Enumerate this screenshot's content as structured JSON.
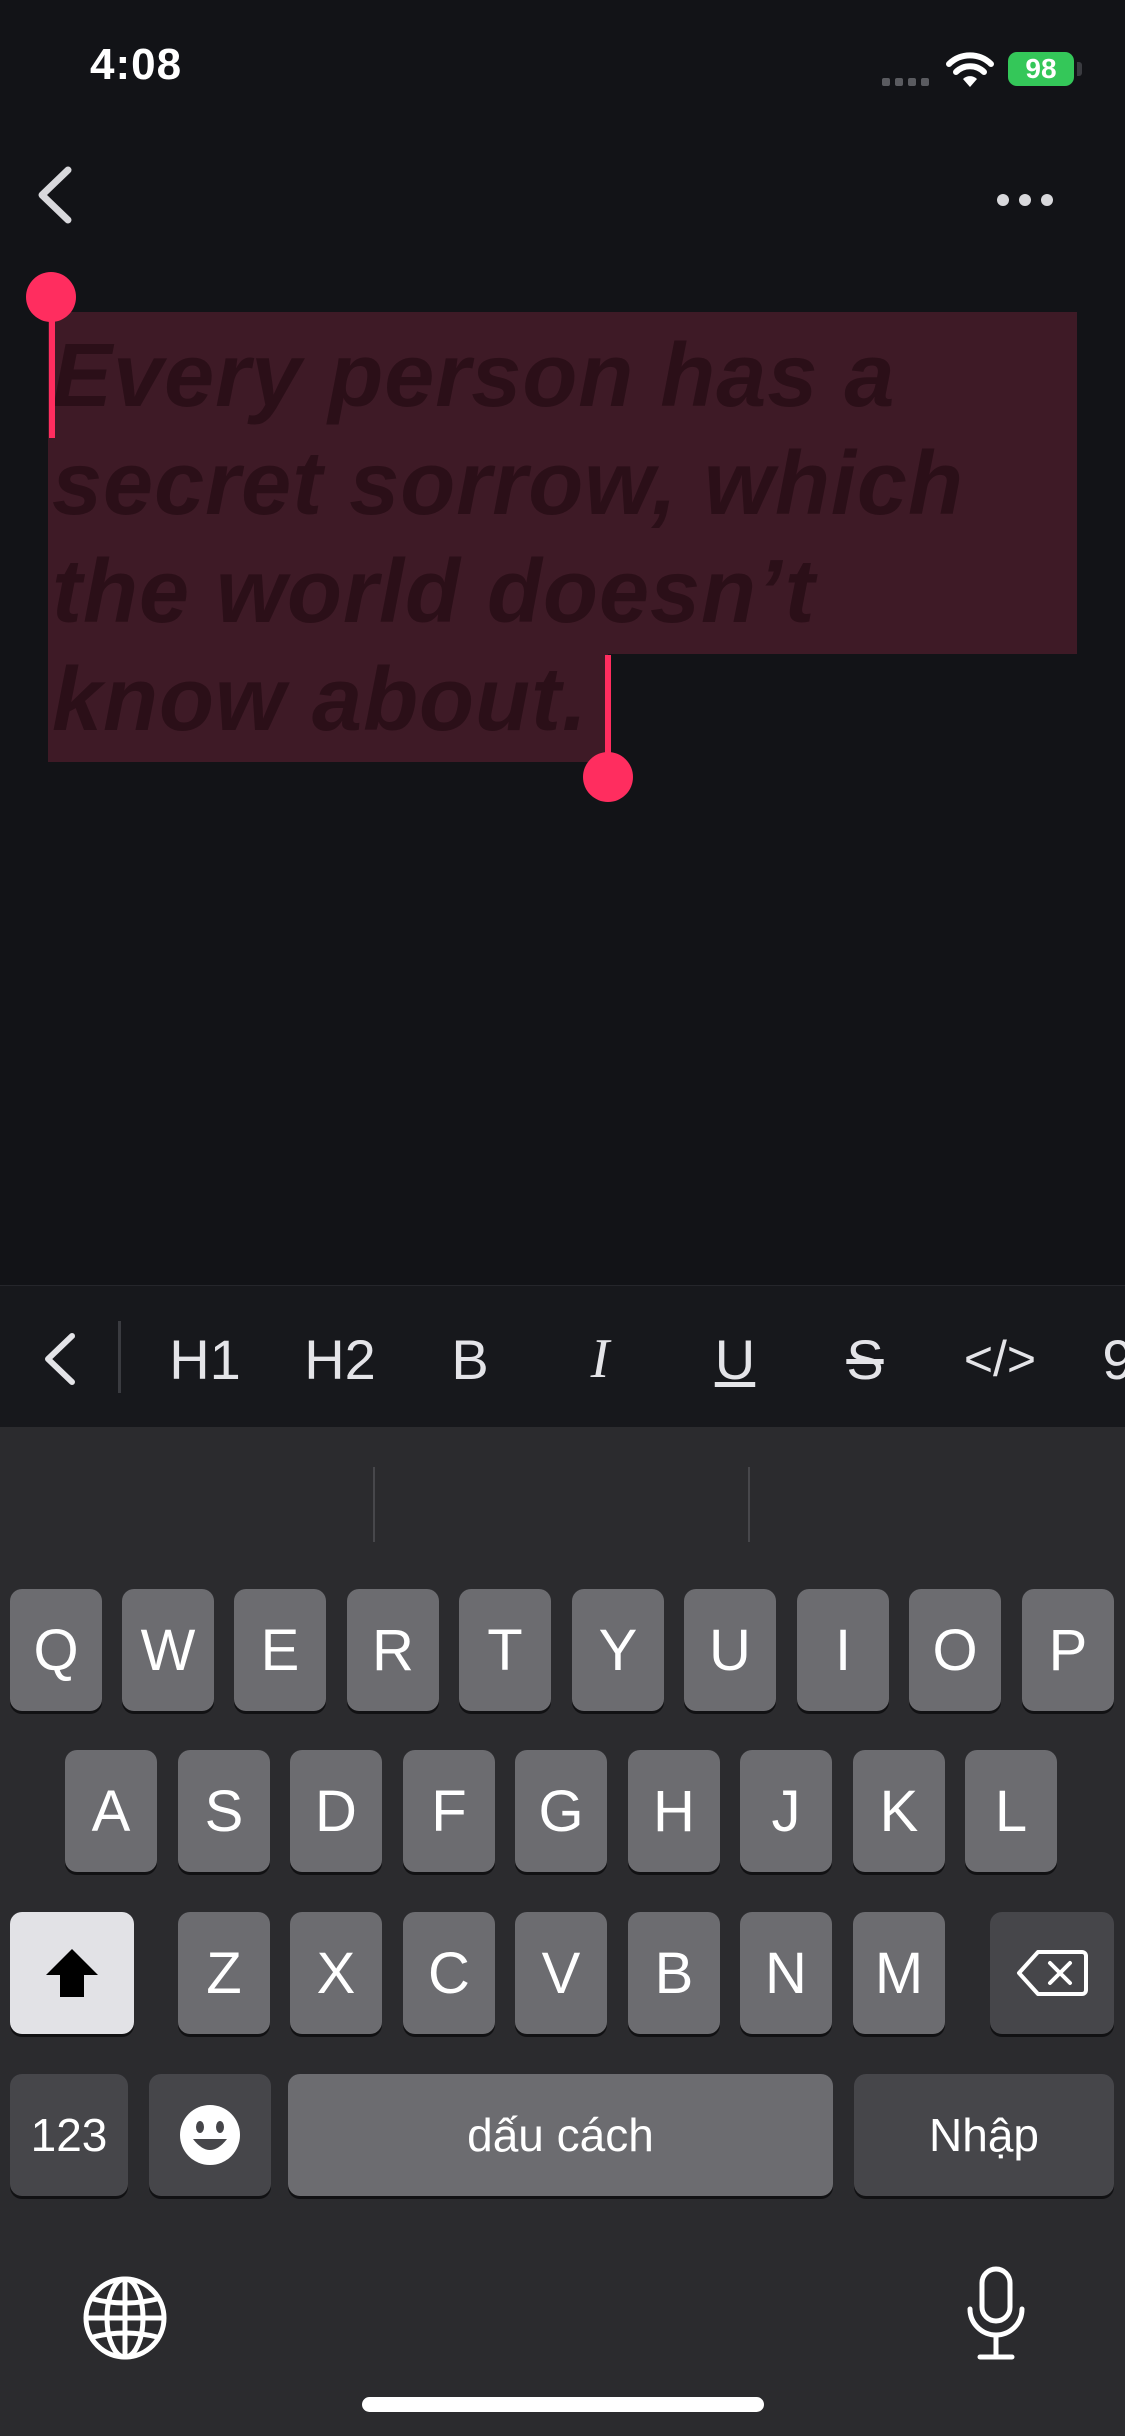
{
  "status_bar": {
    "time": "4:08",
    "battery_level": "98"
  },
  "nav": {
    "back_icon": "chevron-left-icon",
    "more_icon": "ellipsis-icon"
  },
  "editor": {
    "quote_text": "Every person has a secret sorrow, which the world doesn’t know about.",
    "selection_color": "#3e1a26",
    "handle_color": "#ff2d5f"
  },
  "format_toolbar": {
    "collapse_icon": "chevron-left-icon",
    "h1": "H1",
    "h2": "H2",
    "bold": "B",
    "italic": "I",
    "underline": "U",
    "strikethrough": "S",
    "code": "</>",
    "overflow": "9"
  },
  "keyboard": {
    "row1": [
      "Q",
      "W",
      "E",
      "R",
      "T",
      "Y",
      "U",
      "I",
      "O",
      "P"
    ],
    "row2": [
      "A",
      "S",
      "D",
      "F",
      "G",
      "H",
      "J",
      "K",
      "L"
    ],
    "row3": [
      "Z",
      "X",
      "C",
      "V",
      "B",
      "N",
      "M"
    ],
    "numbers_key": "123",
    "space_key": "dấu cách",
    "return_key": "Nhập",
    "shift_icon": "shift-icon",
    "backspace_icon": "backspace-icon",
    "emoji_icon": "emoji-icon",
    "globe_icon": "globe-icon",
    "mic_icon": "microphone-icon"
  }
}
